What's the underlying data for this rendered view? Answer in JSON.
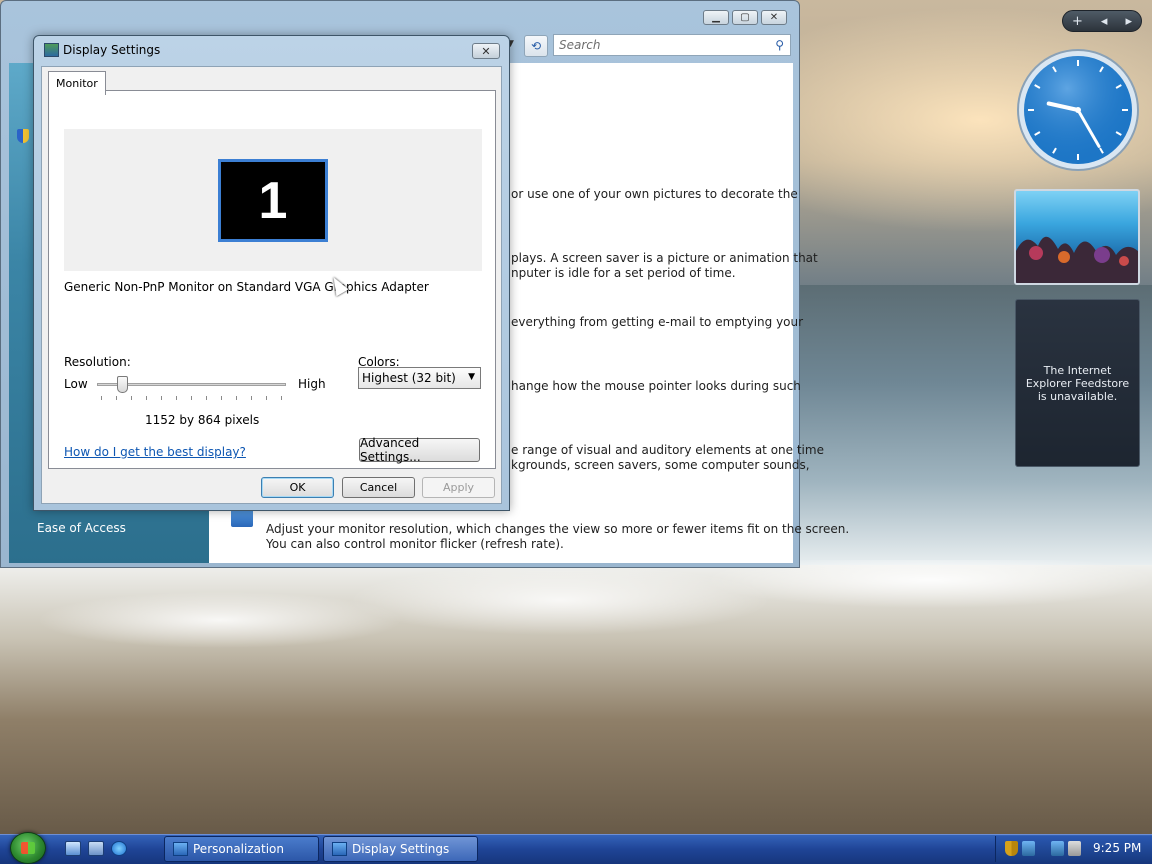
{
  "personalization_window": {
    "search_placeholder": "Search",
    "left_pane_item": "Ease of Access",
    "snippets": [
      "or use one of your own pictures to decorate the",
      "plays. A screen saver is a picture or animation that",
      "nputer is idle for a set period of time.",
      "everything from getting e-mail to emptying your",
      "hange how the mouse pointer looks during such",
      "e range of visual and auditory elements at one time",
      "kgrounds, screen savers, some computer sounds,"
    ],
    "display_description_line1": "Adjust your monitor resolution, which changes the view so more or fewer items fit on the screen.",
    "display_description_line2": "You can also control monitor flicker (refresh rate)."
  },
  "dialog": {
    "title": "Display Settings",
    "close_glyph": "✕",
    "tab": "Monitor",
    "monitor_number": "1",
    "monitor_name": "Generic Non-PnP Monitor on Standard VGA Graphics Adapter",
    "resolution_label": "Resolution:",
    "low_label": "Low",
    "high_label": "High",
    "resolution_value": "1152 by 864 pixels",
    "colors_label": "Colors:",
    "colors_selected": "Highest (32 bit)",
    "help_link": "How do I get the best display?",
    "advanced_button": "Advanced Settings...",
    "ok_button": "OK",
    "cancel_button": "Cancel",
    "apply_button": "Apply"
  },
  "sidebar": {
    "controls": {
      "add": "+",
      "prev": "◂",
      "next": "▸"
    },
    "clock": {
      "hour": 9,
      "minute": 25
    },
    "feed_message": "The Internet Explorer Feedstore is unavailable."
  },
  "taskbar": {
    "tasks": [
      "Personalization",
      "Display Settings"
    ],
    "clock": "9:25 PM"
  },
  "icons": {
    "start": "windows-logo-icon",
    "search": "magnifier-icon"
  },
  "colors": {
    "taskbar": "#1f4496",
    "monitor_border": "#3c7fd3",
    "link": "#0d56b2"
  }
}
